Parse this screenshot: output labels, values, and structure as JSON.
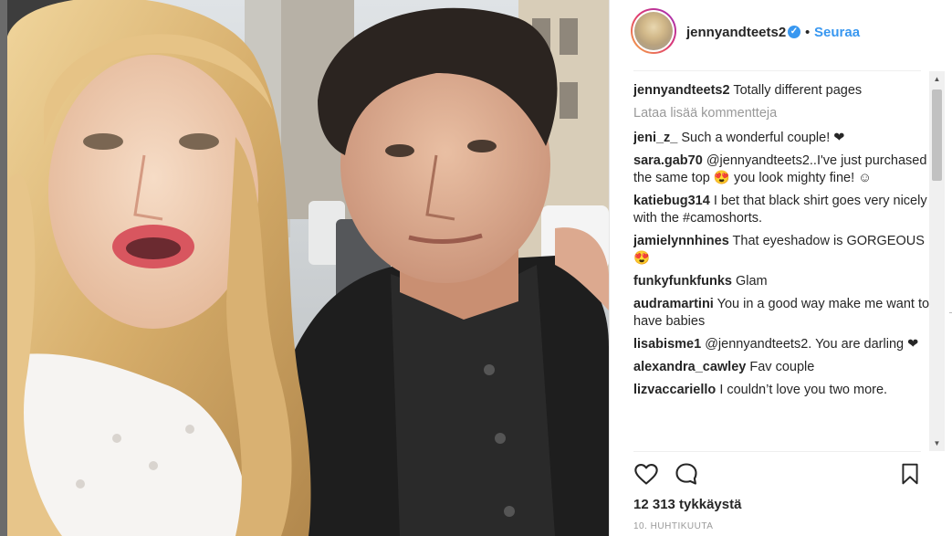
{
  "header": {
    "username": "jennyandteets2",
    "verified_icon": "verified-badge-icon",
    "separator": "•",
    "follow_label": "Seuraa"
  },
  "comments": {
    "caption": {
      "user": "jennyandteets2",
      "text": "Totally different pages"
    },
    "load_more": "Lataa lisää kommentteja",
    "items": [
      {
        "user": "jeni_z_",
        "text": "Such a wonderful couple! ❤"
      },
      {
        "user": "sara.gab70",
        "text": "@jennyandteets2..I've just purchased the same top 😍 you look mighty fine! ☺"
      },
      {
        "user": "katiebug314",
        "text": "I bet that black shirt goes very nicely with the #camoshorts."
      },
      {
        "user": "jamielynnhines",
        "text": "That eyeshadow is GORGEOUS😍"
      },
      {
        "user": "funkyfunkfunks",
        "text": "Glam"
      },
      {
        "user": "audramartini",
        "text": "You in a good way make me want to have babies"
      },
      {
        "user": "lisabisme1",
        "text": "@jennyandteets2. You are darling ❤"
      },
      {
        "user": "alexandra_cawley",
        "text": "Fav couple"
      },
      {
        "user": "lizvaccariello",
        "text": "I couldn’t love you two more."
      }
    ]
  },
  "actions": {
    "like_icon": "heart-outline-icon",
    "comment_icon": "comment-bubble-icon",
    "save_icon": "bookmark-icon"
  },
  "likes_text": "12 313 tykkäystä",
  "date_text": "10. HUHTIKUUTA",
  "colors": {
    "link": "#3897f0",
    "text": "#262626",
    "muted": "#999999"
  }
}
